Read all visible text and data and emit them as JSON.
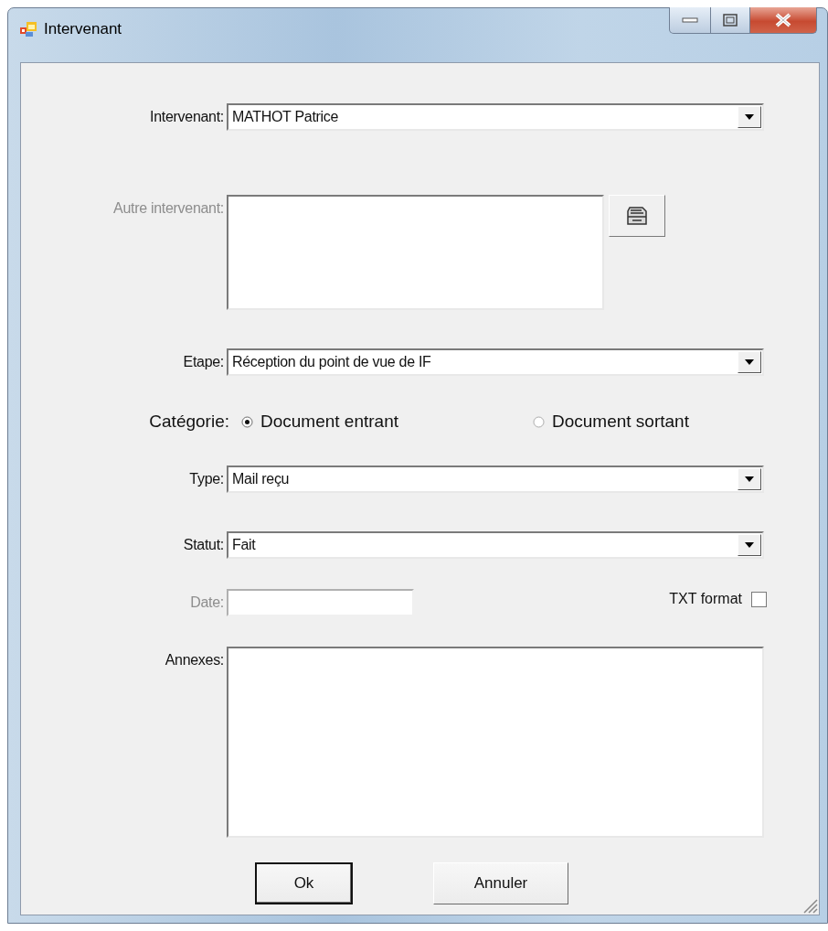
{
  "window": {
    "title": "Intervenant"
  },
  "fields": [
    {
      "kind": "combo",
      "label": "Intervenant:",
      "value": "MATHOT Patrice"
    },
    {
      "kind": "memo",
      "label": "Autre intervenant:",
      "disabled": true,
      "browse": true
    },
    {
      "kind": "combo",
      "label": "Etape:",
      "value": "Réception du point de vue de IF"
    },
    {
      "kind": "radio",
      "label": "Catégorie:",
      "options": [
        {
          "label": "Document entrant",
          "selected": true
        },
        {
          "label": "Document sortant",
          "selected": false
        }
      ]
    },
    {
      "kind": "combo",
      "label": "Type:",
      "value": "Mail reçu"
    },
    {
      "kind": "combo",
      "label": "Statut:",
      "value": "Fait"
    },
    {
      "kind": "date",
      "label": "Date:",
      "disabled": true,
      "checkbox": {
        "label": "TXT format",
        "checked": false
      }
    },
    {
      "kind": "memo",
      "label": "Annexes:"
    }
  ],
  "buttons": [
    {
      "label": "Ok",
      "default": true
    },
    {
      "label": "Annuler",
      "default": false
    }
  ]
}
